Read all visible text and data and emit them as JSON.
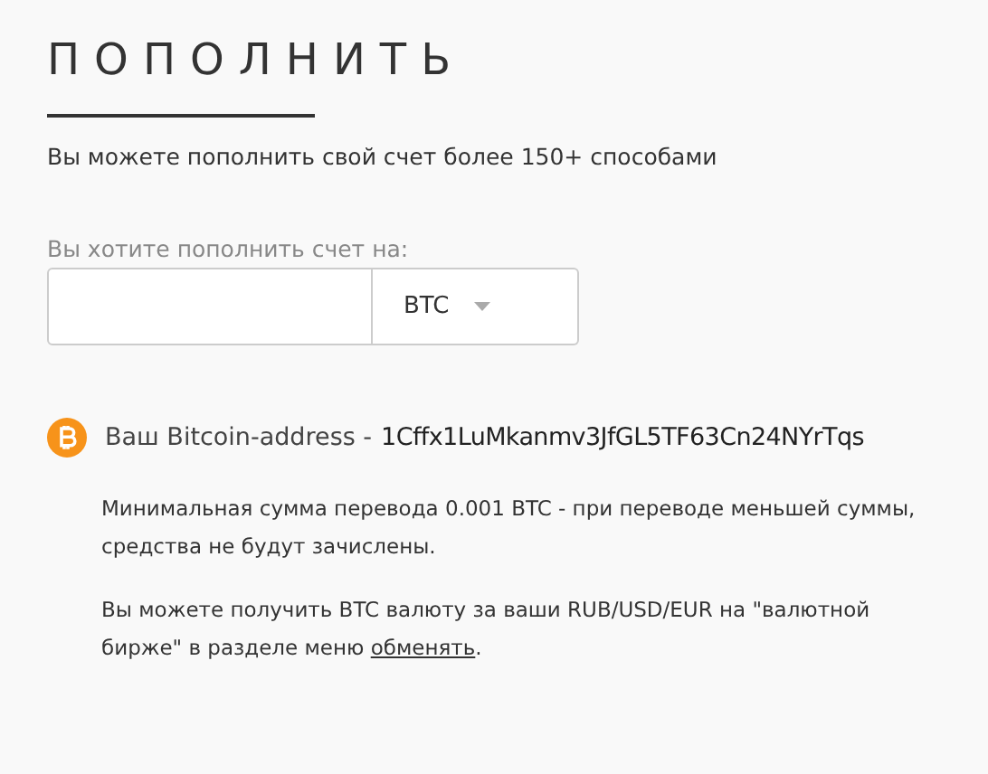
{
  "title": "ПОПОЛНИТЬ",
  "subtitle": "Вы можете пополнить свой счет более 150+ способами",
  "amount_field": {
    "label": "Вы хотите пополнить счет на:",
    "currency": "BTC"
  },
  "address": {
    "label": "Ваш Bitcoin-address -",
    "value": "1Cffx1LuMkanmv3JfGL5TF63Cn24NYrTqs"
  },
  "notes": [
    {
      "text": "Минимальная сумма перевода 0.001 BTC - при переводе меньшей суммы, средства не будут зачислены."
    },
    {
      "text": "Вы можете получить BTC валюту за ваши RUB/USD/EUR на \"валютной бирже\" в разделе меню ",
      "link": "обменять",
      "after": "."
    }
  ]
}
